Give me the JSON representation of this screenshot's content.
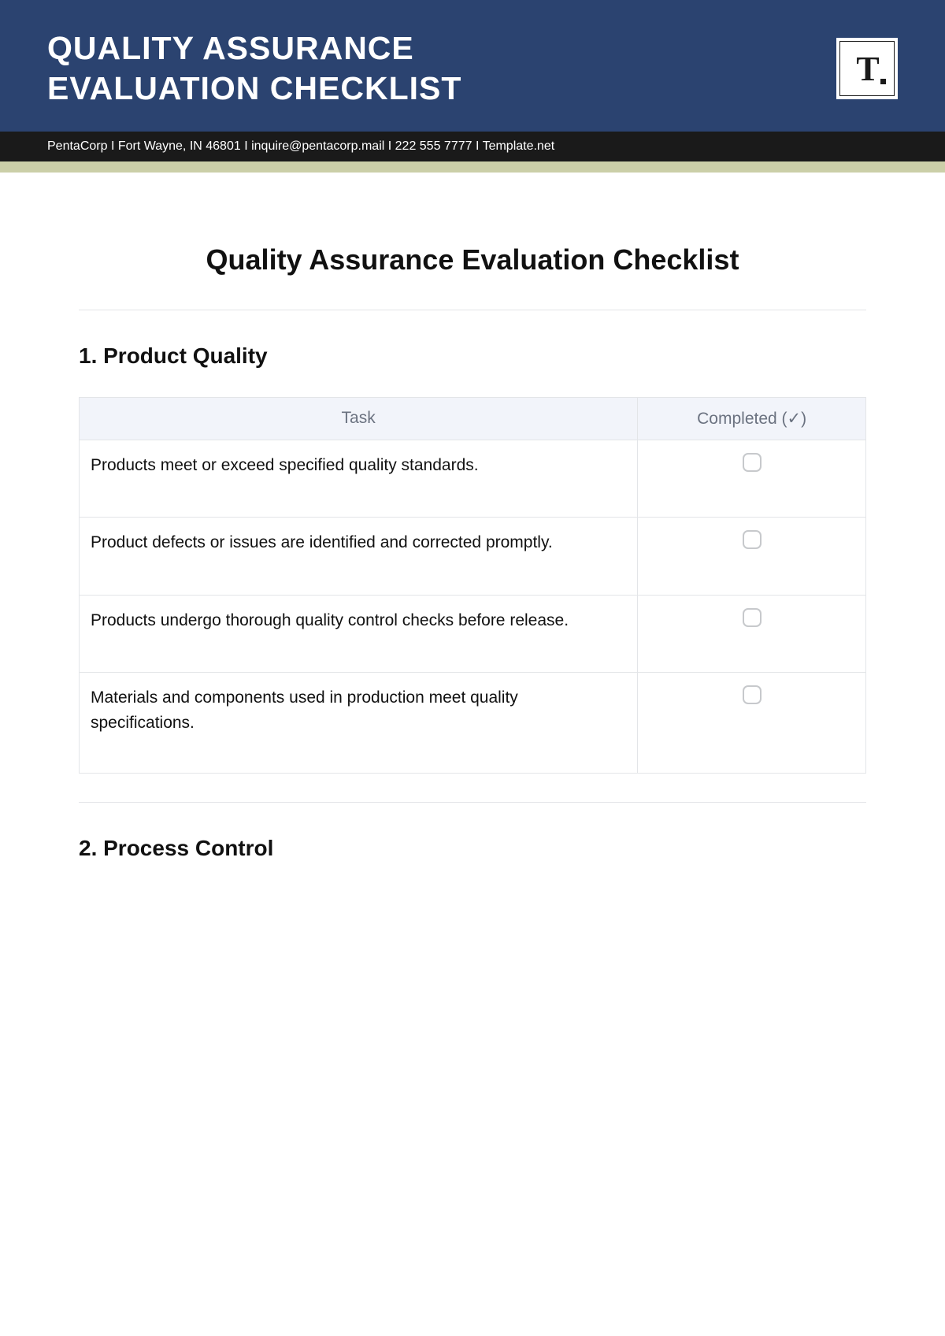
{
  "header": {
    "title_line1": "QUALITY ASSURANCE",
    "title_line2": "EVALUATION CHECKLIST",
    "logo_text": "T",
    "info_bar": "PentaCorp I  Fort Wayne, IN 46801 I inquire@pentacorp.mail  I 222 555 7777 I Template.net"
  },
  "page_title": "Quality Assurance Evaluation Checklist",
  "sections": [
    {
      "heading": "1. Product Quality",
      "columns": {
        "task": "Task",
        "completed": "Completed (✓)"
      },
      "rows": [
        {
          "task": "Products meet or exceed specified quality standards."
        },
        {
          "task": "Product defects or issues are identified and corrected promptly."
        },
        {
          "task": "Products undergo thorough quality control checks before release."
        },
        {
          "task": "Materials and components used in production meet quality specifications."
        }
      ]
    },
    {
      "heading": "2. Process Control"
    }
  ]
}
